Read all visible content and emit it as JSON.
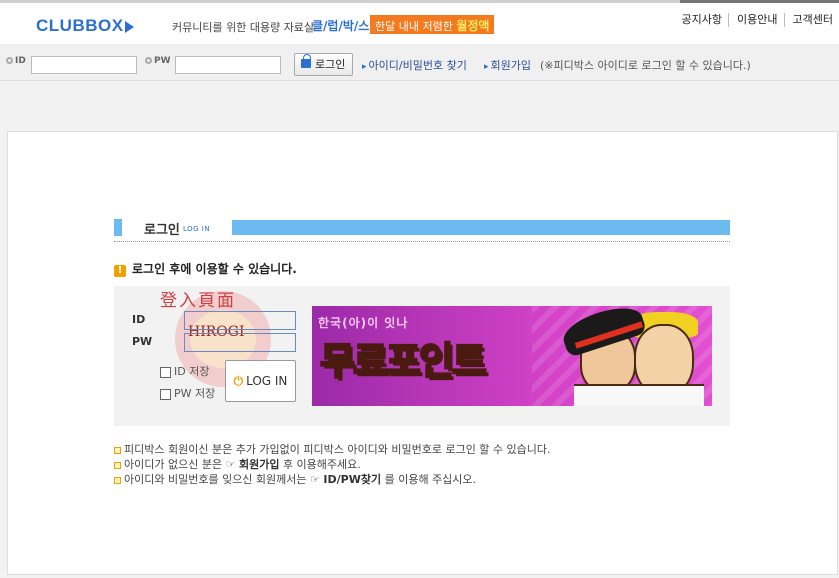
{
  "header": {
    "logo": "CLUBBOX",
    "tagline": "커뮤니티를 위한 대용량 자료실",
    "brand_word": "클/럽/박/스",
    "promo_prefix": "한달 내내 저렴한",
    "promo_highlight": "월정액",
    "nav": [
      "공지사항",
      "이용안내",
      "고객센터"
    ]
  },
  "loginbar": {
    "id_label": "ID",
    "pw_label": "PW",
    "id_value": "",
    "pw_value": "",
    "login_button": "로그인",
    "find_link": "아이디/비밀번호 찾기",
    "join_link": "회원가입",
    "note": "(※피디박스 아이디로 로그인 할 수 있습니다.)"
  },
  "section": {
    "title": "로그인",
    "subtitle": "LOG IN",
    "warning": "로그인 후에 이용할 수 있습니다."
  },
  "form": {
    "id_label": "ID",
    "pw_label": "PW",
    "id_value": "",
    "pw_value": "",
    "save_id": "ID 저장",
    "save_pw": "PW 저장",
    "login_button": "LOG IN"
  },
  "stamp": {
    "text": "登入頁面",
    "mark": "HIROGI"
  },
  "banner": {
    "small_text": "한국(아)이 잇나",
    "big_text": "무료포인트"
  },
  "notes": {
    "line1": "피디박스 회원이신 분은 추가 가입없이 피디박스 아이디와 비밀번호로 로그인 할 수 있습니다.",
    "line2_pre": "아이디가 없으신 분은",
    "line2_bold": "회원가입",
    "line2_post": "후 이용해주세요.",
    "line3_pre": "아이디와 비밀번호를 잊으신 회원께서는",
    "line3_bold": "ID/PW찾기",
    "line3_post": "를 이용해 주십시오."
  }
}
